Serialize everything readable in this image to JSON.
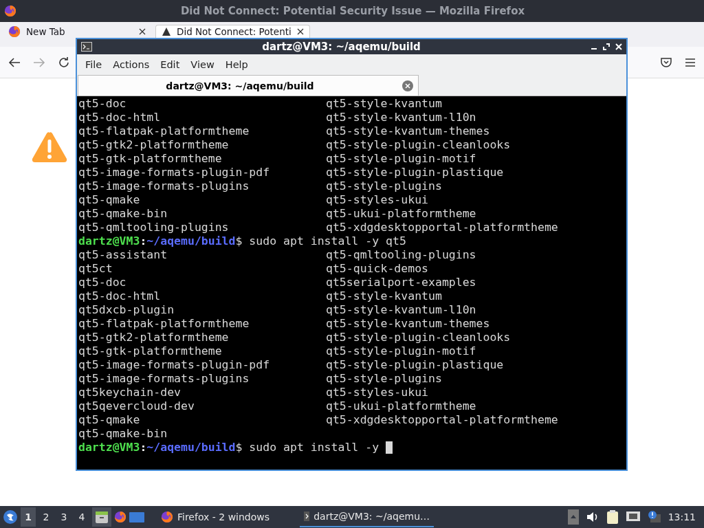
{
  "browser": {
    "title": "Did Not Connect: Potential Security Issue — Mozilla Firefox",
    "tabs": [
      {
        "label": "New Tab",
        "selected": false
      },
      {
        "label": "Did Not Connect: Potenti",
        "selected": true
      }
    ]
  },
  "terminal": {
    "title": "dartz@VM3: ~/aqemu/build",
    "menu": [
      "File",
      "Actions",
      "Edit",
      "View",
      "Help"
    ],
    "tab": "dartz@VM3: ~/aqemu/build",
    "lines": [
      {
        "kind": "columns",
        "left": "qt5-doc",
        "right": "qt5-style-kvantum"
      },
      {
        "kind": "columns",
        "left": "qt5-doc-html",
        "right": "qt5-style-kvantum-l10n"
      },
      {
        "kind": "columns",
        "left": "qt5-flatpak-platformtheme",
        "right": "qt5-style-kvantum-themes"
      },
      {
        "kind": "columns",
        "left": "qt5-gtk2-platformtheme",
        "right": "qt5-style-plugin-cleanlooks"
      },
      {
        "kind": "columns",
        "left": "qt5-gtk-platformtheme",
        "right": "qt5-style-plugin-motif"
      },
      {
        "kind": "columns",
        "left": "qt5-image-formats-plugin-pdf",
        "right": "qt5-style-plugin-plastique"
      },
      {
        "kind": "columns",
        "left": "qt5-image-formats-plugins",
        "right": "qt5-style-plugins"
      },
      {
        "kind": "columns",
        "left": "qt5-qmake",
        "right": "qt5-styles-ukui"
      },
      {
        "kind": "columns",
        "left": "qt5-qmake-bin",
        "right": "qt5-ukui-platformtheme"
      },
      {
        "kind": "columns",
        "left": "qt5-qmltooling-plugins",
        "right": "qt5-xdgdesktopportal-platformtheme"
      },
      {
        "kind": "prompt",
        "user": "dartz@VM3",
        "sep": ":",
        "path": "~/aqemu/build",
        "command": "$ sudo apt install -y qt5",
        "cursor": false
      },
      {
        "kind": "columns",
        "left": "qt5-assistant",
        "right": "qt5-qmltooling-plugins"
      },
      {
        "kind": "columns",
        "left": "qt5ct",
        "right": "qt5-quick-demos"
      },
      {
        "kind": "columns",
        "left": "qt5-doc",
        "right": "qt5serialport-examples"
      },
      {
        "kind": "columns",
        "left": "qt5-doc-html",
        "right": "qt5-style-kvantum"
      },
      {
        "kind": "columns",
        "left": "qt5dxcb-plugin",
        "right": "qt5-style-kvantum-l10n"
      },
      {
        "kind": "columns",
        "left": "qt5-flatpak-platformtheme",
        "right": "qt5-style-kvantum-themes"
      },
      {
        "kind": "columns",
        "left": "qt5-gtk2-platformtheme",
        "right": "qt5-style-plugin-cleanlooks"
      },
      {
        "kind": "columns",
        "left": "qt5-gtk-platformtheme",
        "right": "qt5-style-plugin-motif"
      },
      {
        "kind": "columns",
        "left": "qt5-image-formats-plugin-pdf",
        "right": "qt5-style-plugin-plastique"
      },
      {
        "kind": "columns",
        "left": "qt5-image-formats-plugins",
        "right": "qt5-style-plugins"
      },
      {
        "kind": "columns",
        "left": "qt5keychain-dev",
        "right": "qt5-styles-ukui"
      },
      {
        "kind": "columns",
        "left": "qt5qevercloud-dev",
        "right": "qt5-ukui-platformtheme"
      },
      {
        "kind": "columns",
        "left": "qt5-qmake",
        "right": "qt5-xdgdesktopportal-platformtheme"
      },
      {
        "kind": "columns",
        "left": "qt5-qmake-bin"
      },
      {
        "kind": "prompt",
        "user": "dartz@VM3",
        "sep": ":",
        "path": "~/aqemu/build",
        "command": "$ sudo apt install -y ",
        "cursor": true
      }
    ]
  },
  "taskbar": {
    "workspaces": [
      {
        "label": "1",
        "selected": true
      },
      {
        "label": "2",
        "selected": false
      },
      {
        "label": "3",
        "selected": false
      },
      {
        "label": "4",
        "selected": false
      }
    ],
    "tasks": [
      {
        "label": "Firefox - 2 windows",
        "selected": false,
        "kind": "firefox"
      },
      {
        "label": "dartz@VM3: ~/aqemu…",
        "selected": true,
        "kind": "terminal"
      }
    ],
    "clock": "13:11"
  }
}
